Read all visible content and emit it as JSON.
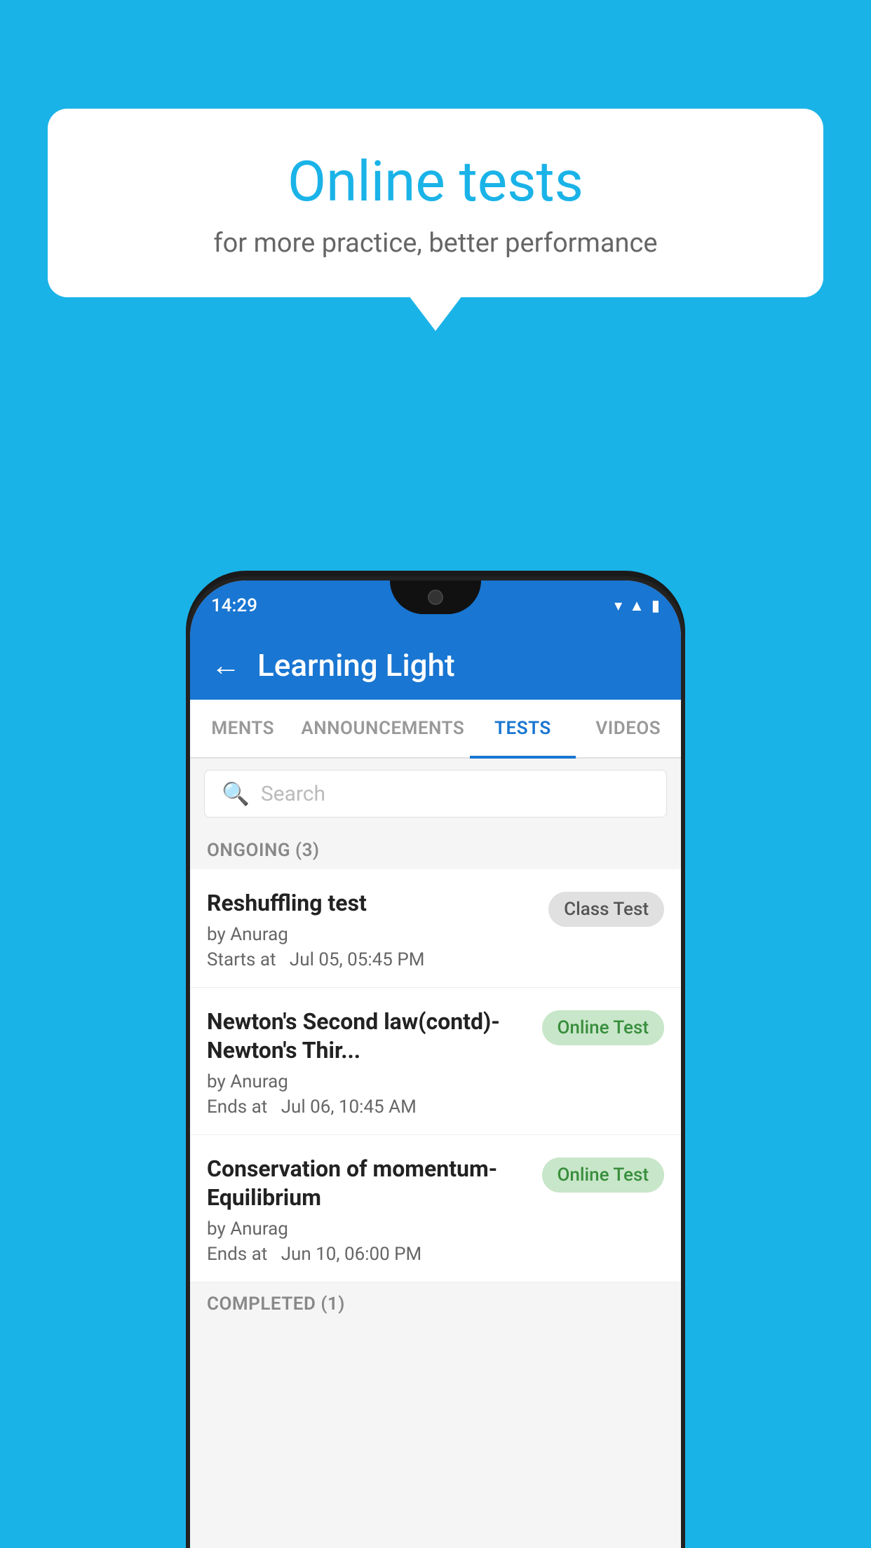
{
  "background": {
    "color": "#1ab3e8"
  },
  "promo": {
    "title": "Online tests",
    "subtitle": "for more practice, better performance"
  },
  "phone": {
    "status": {
      "time": "14:29",
      "icons": [
        "wifi",
        "signal",
        "battery"
      ]
    },
    "appbar": {
      "title": "Learning Light",
      "back_label": "←"
    },
    "tabs": [
      {
        "label": "MENTS",
        "active": false
      },
      {
        "label": "ANNOUNCEMENTS",
        "active": false
      },
      {
        "label": "TESTS",
        "active": true
      },
      {
        "label": "VIDEOS",
        "active": false
      }
    ],
    "search": {
      "placeholder": "Search"
    },
    "ongoing_section": {
      "label": "ONGOING (3)"
    },
    "tests": [
      {
        "name": "Reshuffling test",
        "author": "by Anurag",
        "time_label": "Starts at",
        "time": "Jul 05, 05:45 PM",
        "badge": "Class Test",
        "badge_type": "class"
      },
      {
        "name": "Newton's Second law(contd)-Newton's Thir...",
        "author": "by Anurag",
        "time_label": "Ends at",
        "time": "Jul 06, 10:45 AM",
        "badge": "Online Test",
        "badge_type": "online"
      },
      {
        "name": "Conservation of momentum-Equilibrium",
        "author": "by Anurag",
        "time_label": "Ends at",
        "time": "Jun 10, 06:00 PM",
        "badge": "Online Test",
        "badge_type": "online"
      }
    ],
    "completed_section": {
      "label": "COMPLETED (1)"
    }
  }
}
